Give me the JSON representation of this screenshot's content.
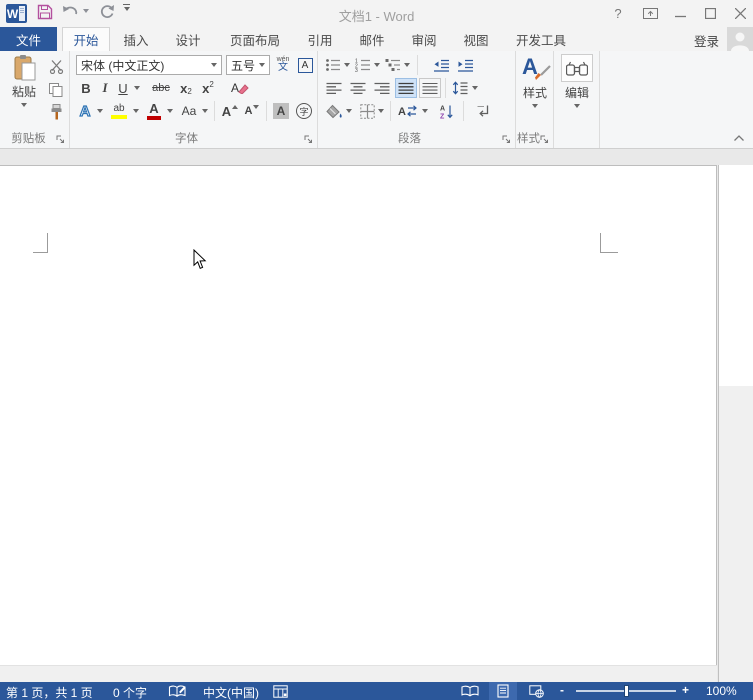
{
  "titlebar": {
    "title": "文档1 - Word",
    "help": "?"
  },
  "tabs": {
    "file": "文件",
    "items": [
      "开始",
      "插入",
      "设计",
      "页面布局",
      "引用",
      "邮件",
      "审阅",
      "视图",
      "开发工具"
    ],
    "signin": "登录"
  },
  "ribbon": {
    "accent_color": "#2b579a",
    "clipboard": {
      "group_label": "剪贴板",
      "paste_label": "粘贴"
    },
    "font": {
      "group_label": "字体",
      "name_value": "宋体 (中文正文)",
      "size_value": "五号",
      "pinyin_top": "wén",
      "pinyin_char": "文",
      "border_char": "A",
      "bold": "B",
      "italic": "I",
      "underline": "U",
      "strike": "abc",
      "sub_char": "x",
      "sub_num": "2",
      "sup_char": "x",
      "sup_num": "2",
      "clear_char": "A",
      "effects_char": "A",
      "highlight_chars": "ab",
      "color_char": "A",
      "case_chars": "Aa",
      "grow_char": "A",
      "shrink_char": "A",
      "shading_char": "A",
      "circle_char": "字"
    },
    "paragraph": {
      "group_label": "段落",
      "asian_char": "A",
      "sort_a": "A",
      "sort_z": "Z"
    },
    "styles": {
      "group_label": "样式",
      "button_label": "样式",
      "icon_char": "A"
    },
    "editing": {
      "button_label": "编辑"
    }
  },
  "statusbar": {
    "page_info": "第 1 页，共 1 页",
    "word_count": "0 个字",
    "language": "中文(中国)",
    "zoom_out": "-",
    "zoom_in": "+",
    "zoom_level": "100%"
  }
}
